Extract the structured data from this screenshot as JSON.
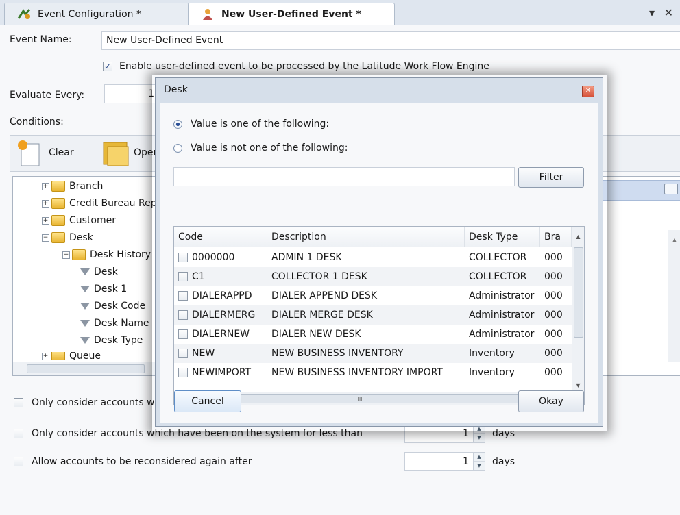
{
  "tabs": [
    {
      "label": "Event Configuration *"
    },
    {
      "label": "New User-Defined Event *"
    }
  ],
  "tab_controls": "▾ ✕",
  "form": {
    "event_name_label": "Event Name:",
    "event_name_value": "New User-Defined Event",
    "enable_label": "Enable user-defined event to be processed by the Latitude Work Flow Engine",
    "evaluate_label": "Evaluate Every:",
    "evaluate_value": "1",
    "conditions_label": "Conditions:",
    "toolbar": {
      "clear": "Clear",
      "open": "Open"
    },
    "tree": [
      {
        "label": "Branch"
      },
      {
        "label": "Credit Bureau Reporting"
      },
      {
        "label": "Customer"
      },
      {
        "label": "Desk"
      },
      {
        "label": "Desk History"
      },
      {
        "label": "Desk"
      },
      {
        "label": "Desk 1"
      },
      {
        "label": "Desk Code"
      },
      {
        "label": "Desk Name"
      },
      {
        "label": "Desk Type"
      },
      {
        "label": "Queue"
      }
    ],
    "options": [
      {
        "label": "Only consider accounts with"
      },
      {
        "label": "Only consider accounts which have been on the system for less than",
        "value": "1",
        "unit": "days"
      },
      {
        "label": "Allow accounts to be reconsidered again after",
        "value": "1",
        "unit": "days"
      }
    ]
  },
  "dialog": {
    "title": "Desk",
    "radio_one_of": "Value is one of the following:",
    "radio_not_one_of": "Value is not one of the following:",
    "filter_value": "",
    "filter_button": "Filter",
    "columns": [
      "Code",
      "Description",
      "Desk Type",
      "Bra"
    ],
    "rows": [
      {
        "code": "0000000",
        "description": "ADMIN 1 DESK",
        "desk_type": "COLLECTOR",
        "branch": "000"
      },
      {
        "code": "C1",
        "description": "COLLECTOR 1 DESK",
        "desk_type": "COLLECTOR",
        "branch": "000"
      },
      {
        "code": "DIALERAPPD",
        "description": "DIALER APPEND DESK",
        "desk_type": "Administrator",
        "branch": "000"
      },
      {
        "code": "DIALERMERG",
        "description": "DIALER MERGE DESK",
        "desk_type": "Administrator",
        "branch": "000"
      },
      {
        "code": "DIALERNEW",
        "description": "DIALER NEW DESK",
        "desk_type": "Administrator",
        "branch": "000"
      },
      {
        "code": "NEW",
        "description": "NEW BUSINESS INVENTORY",
        "desk_type": "Inventory",
        "branch": "000"
      },
      {
        "code": "NEWIMPORT",
        "description": "NEW BUSINESS INVENTORY IMPORT",
        "desk_type": "Inventory",
        "branch": "000"
      }
    ],
    "scroll_thumb_label": "III",
    "cancel": "Cancel",
    "okay": "Okay"
  },
  "colors": {
    "accent": "#2a4f96",
    "tab_bg": "#dfe6ef",
    "dialog_bg": "#d6dfea",
    "close_red": "#d6523a",
    "folder": "#e8b430"
  }
}
